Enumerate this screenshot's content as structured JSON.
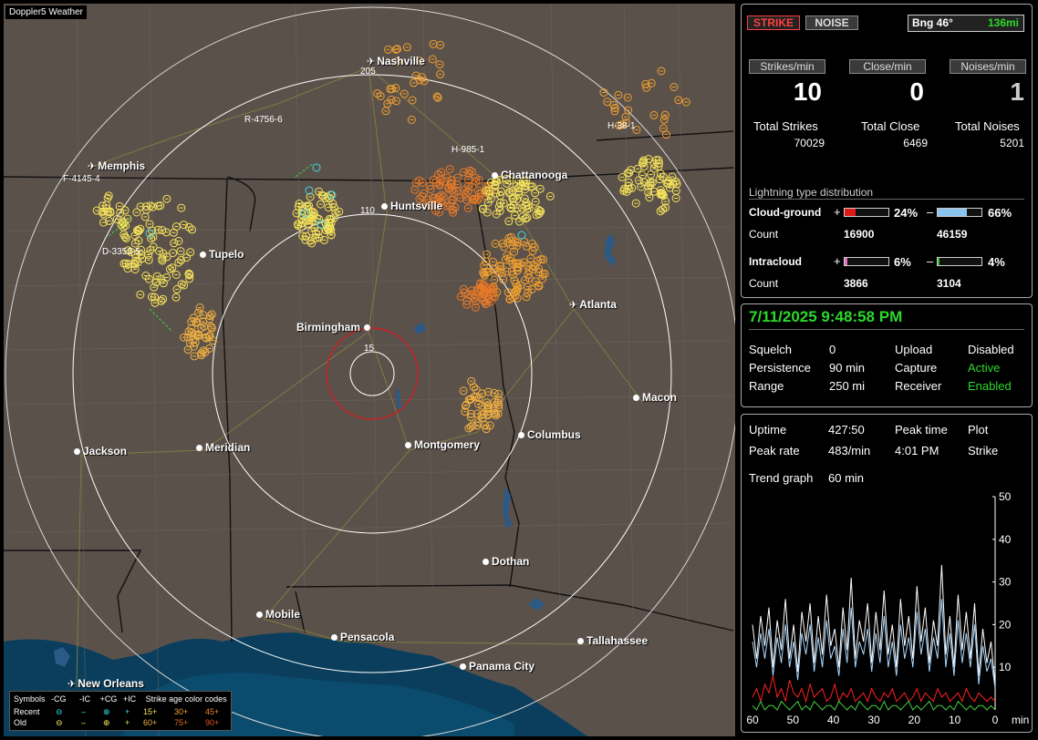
{
  "app": {
    "title": "Doppler5 Weather"
  },
  "map": {
    "cities": [
      {
        "name": "Nashville",
        "icon": "airport-icon"
      },
      {
        "name": "Memphis",
        "icon": "airport-icon"
      },
      {
        "name": "Chattanooga",
        "icon": "dot"
      },
      {
        "name": "Huntsville",
        "icon": "dot"
      },
      {
        "name": "Tupelo",
        "icon": "dot"
      },
      {
        "name": "Atlanta",
        "icon": "airport-icon"
      },
      {
        "name": "Birmingham",
        "icon": "dot"
      },
      {
        "name": "Macon",
        "icon": "dot"
      },
      {
        "name": "Columbus",
        "icon": "dot"
      },
      {
        "name": "Montgomery",
        "icon": "dot"
      },
      {
        "name": "Jackson",
        "icon": "dot"
      },
      {
        "name": "Meridian",
        "icon": "dot"
      },
      {
        "name": "Dothan",
        "icon": "dot"
      },
      {
        "name": "Mobile",
        "icon": "dot"
      },
      {
        "name": "Pensacola",
        "icon": "dot"
      },
      {
        "name": "Tallahassee",
        "icon": "dot"
      },
      {
        "name": "Panama City",
        "icon": "dot"
      },
      {
        "name": "New Orleans",
        "icon": "airport-icon"
      }
    ],
    "stations": [
      "R-4756-6",
      "H-985-1",
      "H-38-1",
      "F-4145-4",
      "D-3352-5"
    ],
    "ring_labels": [
      "205",
      "110",
      "15"
    ]
  },
  "legend": {
    "row1": [
      "Symbols",
      "-CG",
      "-IC",
      "+CG",
      "+IC",
      "Strike age color codes"
    ],
    "recent_label": "Recent",
    "old_label": "Old",
    "recent_ages": [
      "15+",
      "30+",
      "45+"
    ],
    "old_ages": [
      "60+",
      "75+",
      "90+"
    ],
    "colors": {
      "15": "#f5e35a",
      "30": "#f0a030",
      "45": "#e88030",
      "60": "#f0b040",
      "75": "#e86a20",
      "90": "#e85020"
    }
  },
  "status": {
    "strike_button": "STRIKE",
    "noise_button": "NOISE",
    "bearing_label": "Bng 46°",
    "bearing_range": "136mi",
    "rate_headers": [
      "Strikes/min",
      "Close/min",
      "Noises/min"
    ],
    "rates": [
      "10",
      "0",
      "1"
    ],
    "total_labels": [
      "Total Strikes",
      "Total Close",
      "Total Noises"
    ],
    "totals": [
      "70029",
      "6469",
      "5201"
    ]
  },
  "distribution": {
    "title": "Lightning type distribution",
    "cg_label": "Cloud-ground",
    "cg_pos_pct": "24%",
    "cg_neg_pct": "66%",
    "cg_pos_fill": 0.24,
    "cg_neg_fill": 0.66,
    "count_label": "Count",
    "cg_pos_count": "16900",
    "cg_neg_count": "46159",
    "ic_label": "Intracloud",
    "ic_pos_pct": "6%",
    "ic_neg_pct": "4%",
    "ic_pos_fill": 0.06,
    "ic_neg_fill": 0.04,
    "ic_pos_count": "3866",
    "ic_neg_count": "3104",
    "plus": "+",
    "minus": "–"
  },
  "settings": {
    "datetime": "7/11/2025 9:48:58 PM",
    "rows": [
      {
        "k1": "Squelch",
        "v1": "0",
        "k2": "Upload",
        "v2": "Disabled"
      },
      {
        "k1": "Persistence",
        "v1": "90 min",
        "k2": "Capture",
        "v2": "Active"
      },
      {
        "k1": "Range",
        "v1": "250 mi",
        "k2": "Receiver",
        "v2": "Enabled"
      }
    ]
  },
  "stats": {
    "uptime_label": "Uptime",
    "uptime": "427:50",
    "peak_time_label": "Peak time",
    "peak_time": "4:01 PM",
    "plot_label": "Plot",
    "plot_value": "Strike",
    "peak_rate_label": "Peak rate",
    "peak_rate": "483/min",
    "trend_label": "Trend graph",
    "trend_value": "60 min"
  },
  "chart_data": {
    "type": "line",
    "title": "",
    "x_ticks": [
      "60",
      "50",
      "40",
      "30",
      "20",
      "10",
      "0"
    ],
    "x_unit": "min",
    "y_ticks": [
      "50",
      "40",
      "30",
      "20",
      "10"
    ],
    "ylim": [
      0,
      50
    ],
    "xlim": [
      60,
      0
    ],
    "series": [
      {
        "color": "#ffffff",
        "values": [
          20,
          12,
          22,
          15,
          24,
          10,
          21,
          14,
          26,
          12,
          20,
          9,
          23,
          16,
          25,
          11,
          22,
          13,
          27,
          15,
          19,
          10,
          24,
          14,
          31,
          12,
          21,
          16,
          25,
          11,
          23,
          14,
          28,
          13,
          20,
          10,
          26,
          15,
          22,
          12,
          29,
          16,
          24,
          11,
          21,
          15,
          34,
          13,
          22,
          10,
          27,
          14,
          23,
          12,
          25,
          8,
          19,
          11,
          16,
          6
        ]
      },
      {
        "color": "#a8d8ff",
        "values": [
          16,
          10,
          18,
          12,
          19,
          8,
          17,
          11,
          20,
          10,
          16,
          7,
          18,
          13,
          20,
          9,
          17,
          10,
          21,
          12,
          15,
          8,
          19,
          11,
          24,
          10,
          16,
          13,
          19,
          9,
          18,
          11,
          22,
          10,
          16,
          8,
          20,
          12,
          17,
          10,
          23,
          13,
          19,
          9,
          17,
          12,
          26,
          10,
          18,
          8,
          21,
          11,
          18,
          10,
          20,
          6,
          15,
          9,
          12,
          5
        ]
      },
      {
        "color": "#ff2020",
        "values": [
          3,
          5,
          2,
          6,
          4,
          8,
          3,
          5,
          2,
          7,
          4,
          3,
          5,
          2,
          6,
          3,
          4,
          5,
          2,
          3,
          6,
          2,
          4,
          3,
          5,
          2,
          3,
          4,
          2,
          5,
          3,
          2,
          4,
          3,
          5,
          2,
          3,
          4,
          2,
          3,
          5,
          2,
          4,
          3,
          2,
          5,
          3,
          4,
          2,
          3,
          4,
          2,
          5,
          3,
          2,
          4,
          3,
          2,
          3,
          2
        ]
      },
      {
        "color": "#40d040",
        "values": [
          1,
          0,
          2,
          0,
          1,
          1,
          0,
          2,
          1,
          0,
          1,
          2,
          0,
          1,
          0,
          2,
          1,
          0,
          1,
          1,
          0,
          2,
          1,
          0,
          1,
          0,
          2,
          1,
          0,
          1,
          1,
          0,
          2,
          0,
          1,
          1,
          0,
          1,
          2,
          0,
          1,
          0,
          1,
          2,
          0,
          1,
          1,
          0,
          1,
          0,
          2,
          1,
          0,
          1,
          0,
          1,
          1,
          0,
          1,
          0
        ]
      }
    ]
  }
}
